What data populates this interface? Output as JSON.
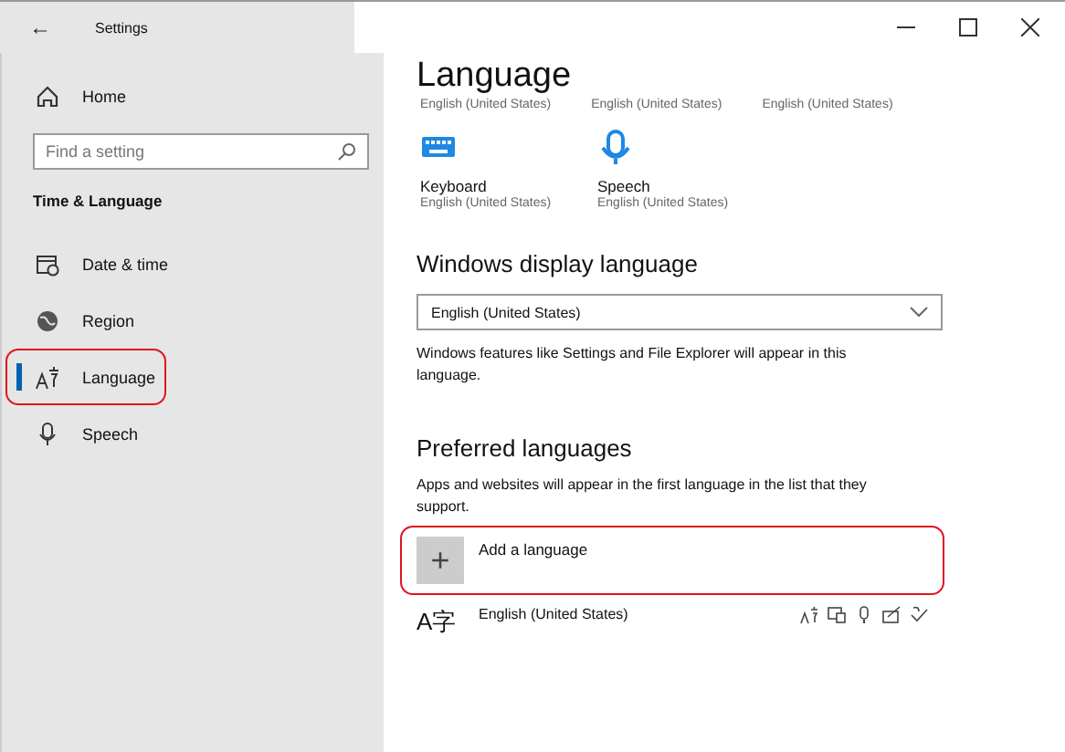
{
  "window": {
    "title": "Settings",
    "back": "←"
  },
  "sidebar": {
    "home": "Home",
    "search": {
      "placeholder": "Find a setting"
    },
    "section": "Time & Language",
    "items": [
      {
        "label": "Date & time",
        "kind": "calendar",
        "selected": false,
        "highlighted": false
      },
      {
        "label": "Region",
        "kind": "globe",
        "selected": false,
        "highlighted": false
      },
      {
        "label": "Language",
        "kind": "language",
        "selected": true,
        "highlighted": true
      },
      {
        "label": "Speech",
        "kind": "mic",
        "selected": false,
        "highlighted": false
      }
    ]
  },
  "page": {
    "title": "Language",
    "summary": [
      "English (United States)",
      "English (United States)",
      "English (United States)"
    ],
    "quick_links": [
      {
        "kind": "keyboard",
        "label": "Keyboard",
        "value": "English (United States)"
      },
      {
        "kind": "mic",
        "label": "Speech",
        "value": "English (United States)"
      }
    ],
    "display_language": {
      "heading": "Windows display language",
      "value": "English (United States)",
      "note": "Windows features like Settings and File Explorer will appear in this language."
    },
    "preferred": {
      "heading": "Preferred languages",
      "note": "Apps and websites will appear in the first language in the list that they support.",
      "add": {
        "label": "Add a language",
        "symbol": "+",
        "highlighted": true
      },
      "languages": [
        {
          "glyph": "A字",
          "name": "English (United States)"
        }
      ]
    }
  }
}
